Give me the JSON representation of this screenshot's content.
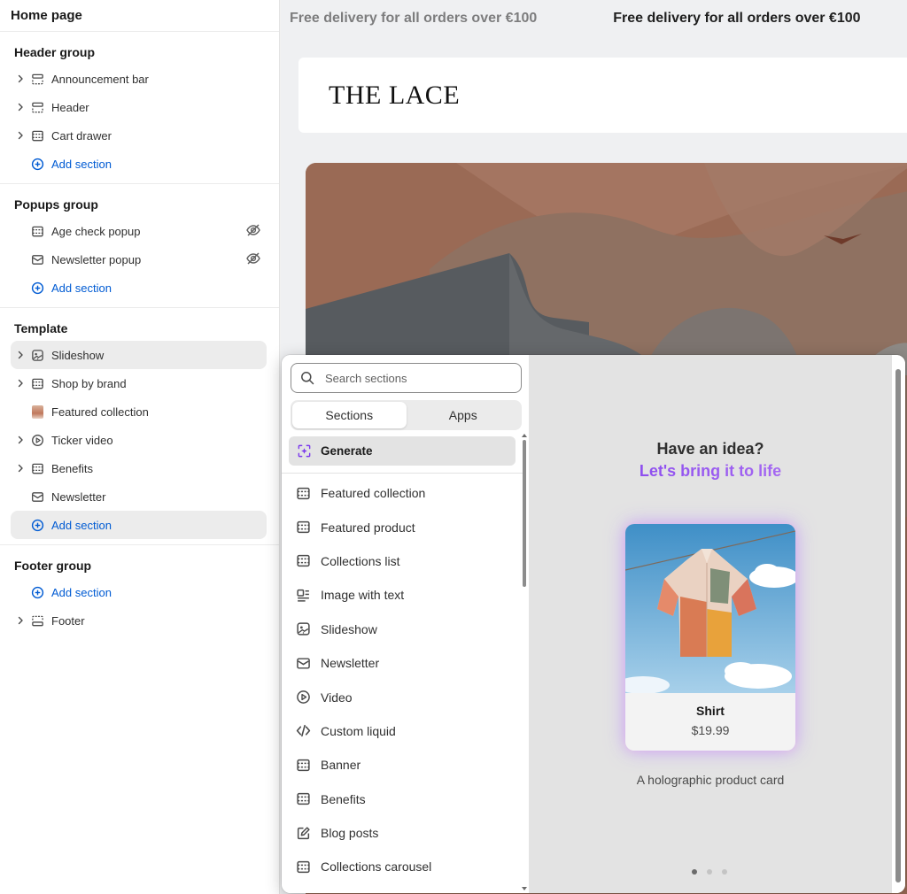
{
  "sidebar": {
    "title": "Home page",
    "groups": [
      {
        "title": "Header group",
        "items": [
          {
            "label": "Announcement bar",
            "icon": "section-header-icon"
          },
          {
            "label": "Header",
            "icon": "section-header-icon"
          },
          {
            "label": "Cart drawer",
            "icon": "section-icon"
          }
        ],
        "add_label": "Add section"
      },
      {
        "title": "Popups group",
        "items": [
          {
            "label": "Age check popup",
            "icon": "section-icon",
            "hidden": true
          },
          {
            "label": "Newsletter popup",
            "icon": "mail-icon",
            "hidden": true
          }
        ],
        "add_label": "Add section"
      },
      {
        "title": "Template",
        "items": [
          {
            "label": "Slideshow",
            "icon": "slideshow-icon",
            "selected": true
          },
          {
            "label": "Shop by brand",
            "icon": "section-icon"
          },
          {
            "label": "Featured collection",
            "icon": "product-thumbnail"
          },
          {
            "label": "Ticker video",
            "icon": "play-icon"
          },
          {
            "label": "Benefits",
            "icon": "section-icon"
          },
          {
            "label": "Newsletter",
            "icon": "mail-icon"
          }
        ],
        "add_label": "Add section"
      },
      {
        "title": "Footer group",
        "add_label": "Add section",
        "items": [
          {
            "label": "Footer",
            "icon": "section-footer-icon"
          }
        ]
      }
    ]
  },
  "preview": {
    "announcement": "Free delivery for all orders over €100",
    "announcement_repeat": "Free delivery for all orders over €100",
    "logo": "THE LACE"
  },
  "picker": {
    "search_placeholder": "Search sections",
    "tabs": [
      "Sections",
      "Apps"
    ],
    "active_tab": "Sections",
    "generate_label": "Generate",
    "sections": [
      {
        "label": "Featured collection",
        "icon": "section-icon"
      },
      {
        "label": "Featured product",
        "icon": "section-icon"
      },
      {
        "label": "Collections list",
        "icon": "section-icon"
      },
      {
        "label": "Image with text",
        "icon": "image-text-icon"
      },
      {
        "label": "Slideshow",
        "icon": "slideshow-icon"
      },
      {
        "label": "Newsletter",
        "icon": "mail-icon"
      },
      {
        "label": "Video",
        "icon": "play-icon"
      },
      {
        "label": "Custom liquid",
        "icon": "code-icon"
      },
      {
        "label": "Banner",
        "icon": "section-icon"
      },
      {
        "label": "Benefits",
        "icon": "section-icon"
      },
      {
        "label": "Blog posts",
        "icon": "edit-icon"
      },
      {
        "label": "Collections carousel",
        "icon": "section-icon"
      }
    ],
    "promo": {
      "title": "Have an idea?",
      "subtitle": "Let's bring it to life",
      "card_name": "Shirt",
      "card_price": "$19.99",
      "caption": "A holographic product card",
      "active_slide": 1,
      "slide_count": 3
    }
  },
  "colors": {
    "link_blue": "#005bd3",
    "accent_purple": "#8e5df1",
    "selected_bg": "#ececec",
    "hero_brown": "#9a6a55"
  }
}
